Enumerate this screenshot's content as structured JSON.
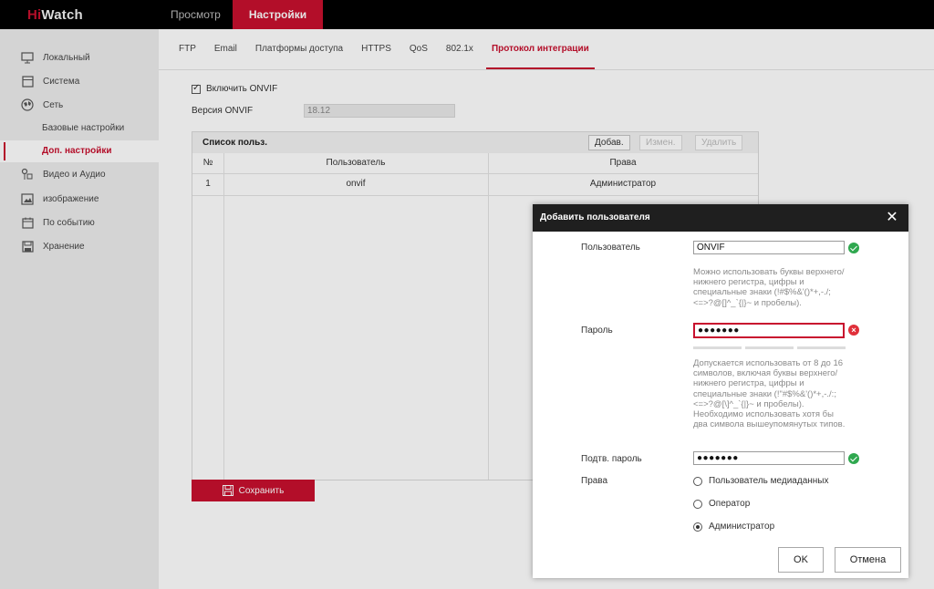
{
  "logo": {
    "red": "Hi",
    "white": "Watch"
  },
  "topnav": {
    "preview": "Просмотр",
    "settings": "Настройки"
  },
  "sidebar": {
    "local": "Локальный",
    "system": "Система",
    "network": "Сеть",
    "network_basic": "Базовые настройки",
    "network_advanced": "Доп. настройки",
    "video_audio": "Видео и Аудио",
    "image": "изображение",
    "event": "По событию",
    "storage": "Хранение"
  },
  "tabs": [
    "FTP",
    "Email",
    "Платформы доступа",
    "HTTPS",
    "QoS",
    "802.1x",
    "Протокол интеграции"
  ],
  "form": {
    "enable_onvif": "Включить ONVIF",
    "version_label": "Версия ONVIF",
    "version_value": "18.12"
  },
  "user_list": {
    "title": "Список польз.",
    "add": "Добав.",
    "edit": "Измен.",
    "delete": "Удалить",
    "col_no": "№",
    "col_user": "Пользователь",
    "col_rights": "Права",
    "rows": [
      {
        "no": "1",
        "user": "onvif",
        "rights": "Администратор"
      }
    ]
  },
  "save_label": "Сохранить",
  "dialog": {
    "title": "Добавить пользователя",
    "close": "✕",
    "user_label": "Пользователь",
    "user_value": "ONVIF",
    "user_hint": "Можно использовать буквы верхнего/нижнего регистра, цифры и специальные знаки (!#$%&'()*+,-./;<=>?@[]^_`{|}~ и пробелы).",
    "password_label": "Пароль",
    "password_value": "●●●●●●●",
    "password_hint": "Допускается использовать от 8 до 16 символов, включая буквы верхнего/нижнего регистра, цифры и специальные знаки (!\"#$%&'()*+,-./:;<=>?@[\\]^_`{|}~ и пробелы). Необходимо использовать хотя бы два символа вышеупомянутых типов.",
    "confirm_label": "Подтв. пароль",
    "confirm_value": "●●●●●●●",
    "rights_label": "Права",
    "rights": {
      "media_user": "Пользователь медиаданных",
      "operator": "Оператор",
      "admin": "Администратор"
    },
    "ok": "OK",
    "cancel": "Отмена"
  },
  "colors": {
    "accent": "#c8102e",
    "ok": "#2fa84f",
    "error": "#e0303a"
  }
}
